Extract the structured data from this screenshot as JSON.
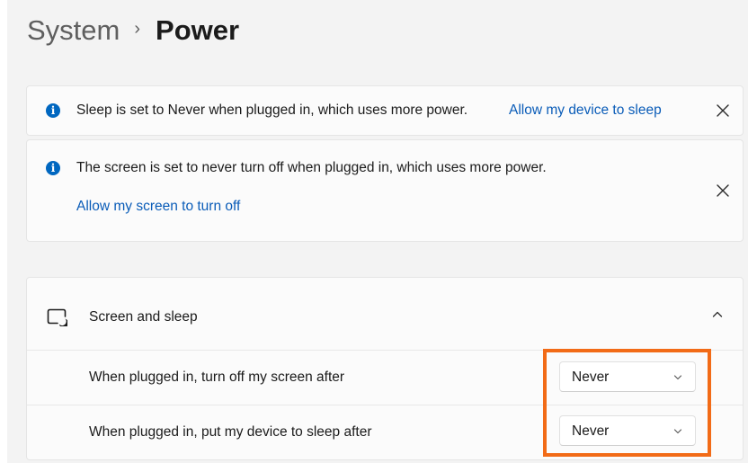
{
  "breadcrumb": {
    "parent": "System",
    "separator": "›",
    "current": "Power"
  },
  "banners": [
    {
      "icon": "info-icon",
      "message": "Sleep is set to Never when plugged in, which uses more power.",
      "link": "Allow my device to sleep"
    },
    {
      "icon": "info-icon",
      "message": "The screen is set to never turn off when plugged in, which uses more power.",
      "link": "Allow my screen to turn off"
    }
  ],
  "screen_and_sleep": {
    "icon": "screen-and-sleep-icon",
    "title": "Screen and sleep",
    "expanded": true,
    "rows": [
      {
        "label": "When plugged in, turn off my screen after",
        "value": "Never"
      },
      {
        "label": "When plugged in, put my device to sleep after",
        "value": "Never"
      }
    ]
  },
  "colors": {
    "background": "#f3f3f3",
    "card": "#fbfbfb",
    "accent": "#0067c0",
    "link": "#0a5cb8",
    "highlight": "#f26b17"
  }
}
